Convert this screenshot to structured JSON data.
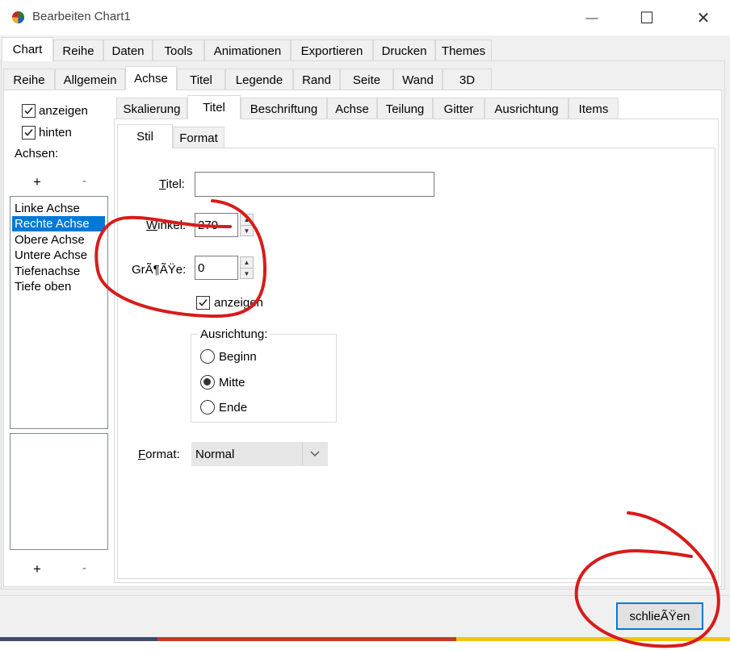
{
  "window": {
    "title": "Bearbeiten Chart1",
    "minimize_glyph": "—",
    "maximize_glyph": "☐",
    "close_glyph": "✕"
  },
  "main_tabs": [
    "Chart",
    "Reihe",
    "Daten",
    "Tools",
    "Animationen",
    "Exportieren",
    "Drucken",
    "Themes"
  ],
  "sub_tabs": [
    "Reihe",
    "Allgemein",
    "Achse",
    "Titel",
    "Legende",
    "Rand",
    "Seite",
    "Wand",
    "3D"
  ],
  "axis_tabs": [
    "Skalierung",
    "Titel",
    "Beschriftung",
    "Achse",
    "Teilung",
    "Gitter",
    "Ausrichtung",
    "Items"
  ],
  "title_tabs": [
    "Stil",
    "Format"
  ],
  "left_panel": {
    "show_label": "anzeigen",
    "behind_label": "hinten",
    "axes_label": "Achsen:",
    "add_label": "+",
    "remove_label": "-",
    "axes": [
      "Linke Achse",
      "Rechte Achse",
      "Obere Achse",
      "Untere Achse",
      "Tiefenachse",
      "Tiefe oben"
    ],
    "selected_index": 1,
    "add2_label": "+",
    "remove2_label": "-"
  },
  "form": {
    "titel_label_first": "T",
    "titel_label_rest": "itel:",
    "titel_value": "",
    "winkel_label_first": "W",
    "winkel_label_rest": "inkel:",
    "winkel_value": "270",
    "groesse_label": "GrÃ¶ÃŸe:",
    "groesse_value": "0",
    "show_label": "anzeigen",
    "alignment_group_label": "Ausrichtung:",
    "align_options": [
      "Beginn",
      "Mitte",
      "Ende"
    ],
    "align_selected": "Mitte",
    "format_label_first": "F",
    "format_label_rest": "ormat:",
    "format_value": "Normal"
  },
  "footer": {
    "close_button": "schlieÃŸen"
  },
  "colors": {
    "selection": "#0078d7",
    "annotation": "#d81b1b",
    "button_border": "#0078d7"
  }
}
